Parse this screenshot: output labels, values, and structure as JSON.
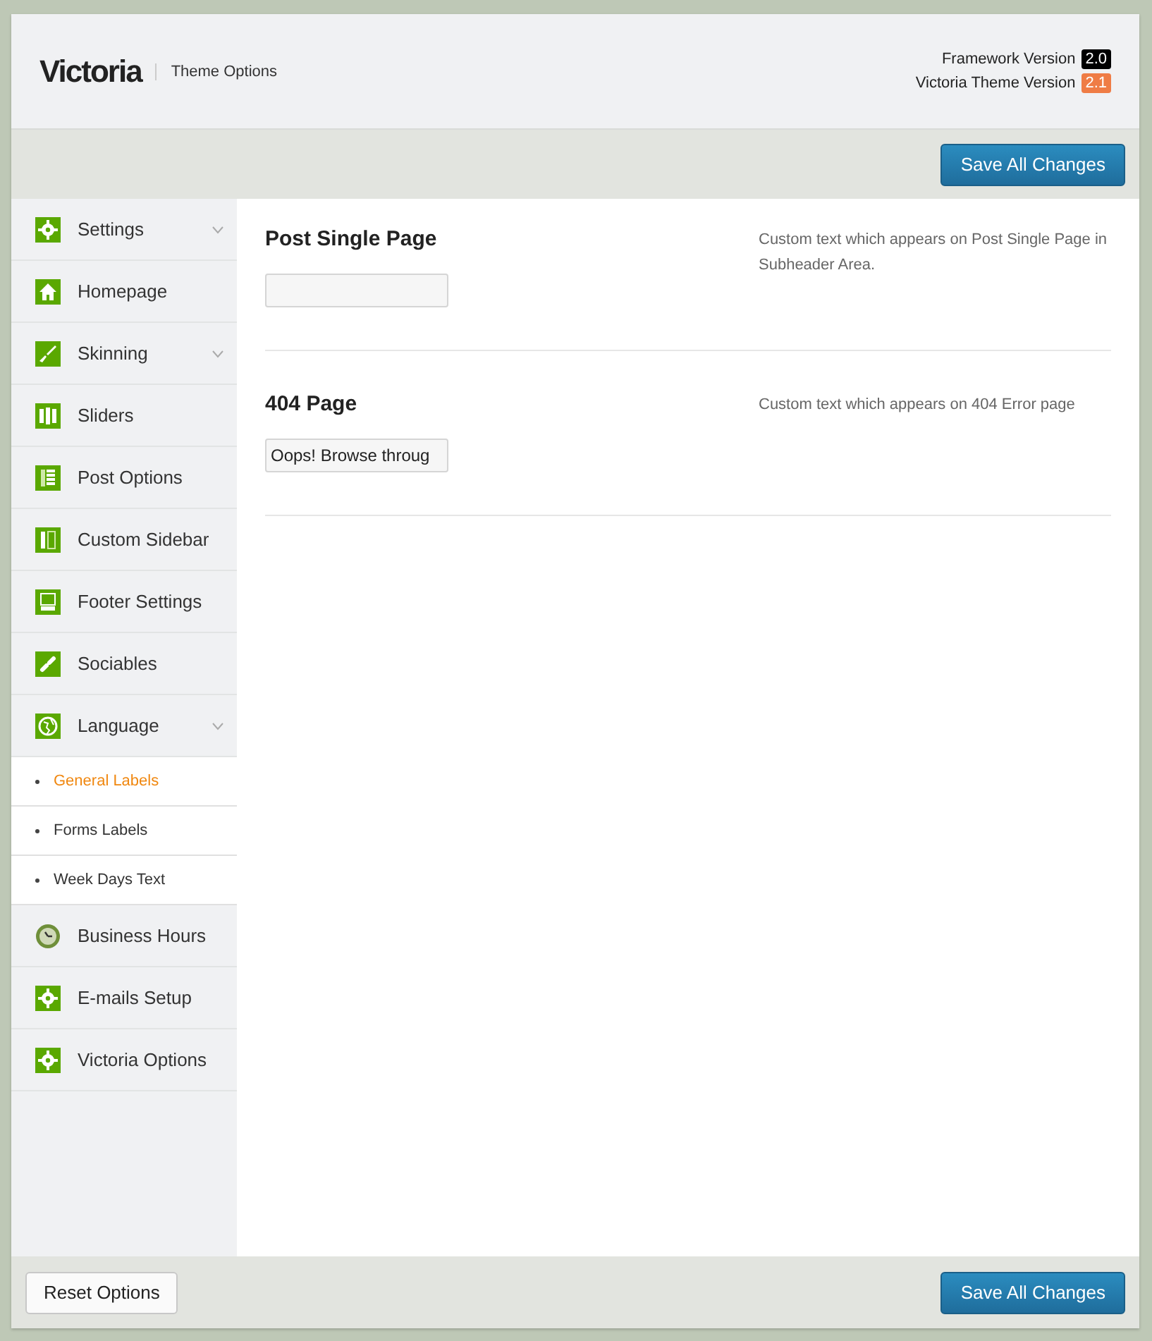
{
  "header": {
    "title": "Victoria",
    "subtitle": "Theme Options",
    "versions": [
      {
        "label": "Framework Version",
        "value": "2.0",
        "color": "#000000"
      },
      {
        "label": "Victoria Theme Version",
        "value": "2.1",
        "color": "#ef7c45"
      }
    ]
  },
  "toolbar": {
    "button": "Save All Changes"
  },
  "sidebar": {
    "items": [
      {
        "label": "Settings",
        "kind": "gear",
        "submenu": true
      },
      {
        "label": "Homepage",
        "kind": "home",
        "submenu": false
      },
      {
        "label": "Skinning",
        "kind": "brush",
        "submenu": true
      },
      {
        "label": "Sliders",
        "kind": "sliders",
        "submenu": false
      },
      {
        "label": "Post Options",
        "kind": "post",
        "submenu": false
      },
      {
        "label": "Custom Sidebar",
        "kind": "sidebar",
        "submenu": false
      },
      {
        "label": "Footer Settings",
        "kind": "footer",
        "submenu": false
      },
      {
        "label": "Sociables",
        "kind": "link",
        "submenu": false
      },
      {
        "label": "Language",
        "kind": "globe",
        "submenu": true,
        "children": [
          {
            "label": "General Labels",
            "selected": true
          },
          {
            "label": "Forms Labels",
            "selected": false
          },
          {
            "label": "Week Days Text",
            "selected": false
          }
        ]
      },
      {
        "label": "Business Hours",
        "kind": "clock",
        "submenu": false
      },
      {
        "label": "E-mails Setup",
        "kind": "gear",
        "submenu": false
      },
      {
        "label": "Victoria Options",
        "kind": "gear",
        "submenu": false
      }
    ]
  },
  "options": [
    {
      "title": "Post Single Page",
      "description": "Custom text which appears on Post Single Page in Subheader Area."
    },
    {
      "title": "404 Page",
      "value": "Oops! Browse throug",
      "description": "Custom text which appears on 404 Error page"
    }
  ],
  "footer": {
    "reset_button": "Reset Options",
    "save_button": "Save All Changes"
  }
}
